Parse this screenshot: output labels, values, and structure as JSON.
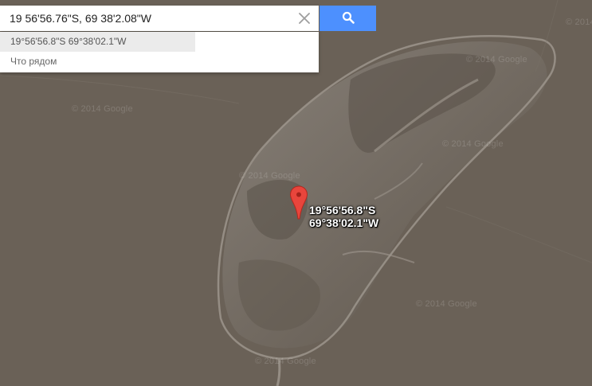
{
  "search": {
    "query": "19 56'56.76\"S, 69 38'2.08\"W",
    "clear_icon": "close-icon",
    "search_icon": "search-icon",
    "button_color": "#4d90fe"
  },
  "suggestions": [
    {
      "label": "19°56'56.8\"S 69°38'02.1\"W"
    },
    {
      "label": "Что рядом"
    }
  ],
  "marker": {
    "icon": "map-pin-icon",
    "color": "#e8453c",
    "lat_label": "19°56'56.8\"S",
    "lng_label": "69°38'02.1\"W"
  },
  "map": {
    "type": "satellite",
    "watermark": "© 2014 Google"
  }
}
